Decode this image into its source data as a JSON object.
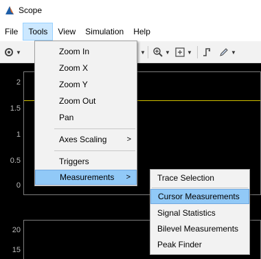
{
  "window": {
    "title": "Scope"
  },
  "menubar": {
    "items": [
      "File",
      "Tools",
      "View",
      "Simulation",
      "Help"
    ]
  },
  "axes": {
    "top_ticks": [
      "2",
      "1.5",
      "1",
      "0.5",
      "0"
    ],
    "bottom_ticks": [
      "20",
      "15"
    ]
  },
  "tools_menu": {
    "items": [
      "Zoom In",
      "Zoom X",
      "Zoom Y",
      "Zoom Out",
      "Pan",
      "Axes Scaling",
      "Triggers",
      "Measurements"
    ]
  },
  "measurements_menu": {
    "items": [
      "Trace Selection",
      "Cursor Measurements",
      "Signal Statistics",
      "Bilevel Measurements",
      "Peak Finder"
    ]
  },
  "colors": {
    "signal": "#d4c200",
    "highlight": "#91c9f7",
    "menu_active": "#cce8ff"
  },
  "icons": [
    "matlab-logo-icon",
    "gear-icon",
    "zoom-in-icon",
    "fit-to-view-icon",
    "trigger-icon",
    "edit-icon"
  ]
}
